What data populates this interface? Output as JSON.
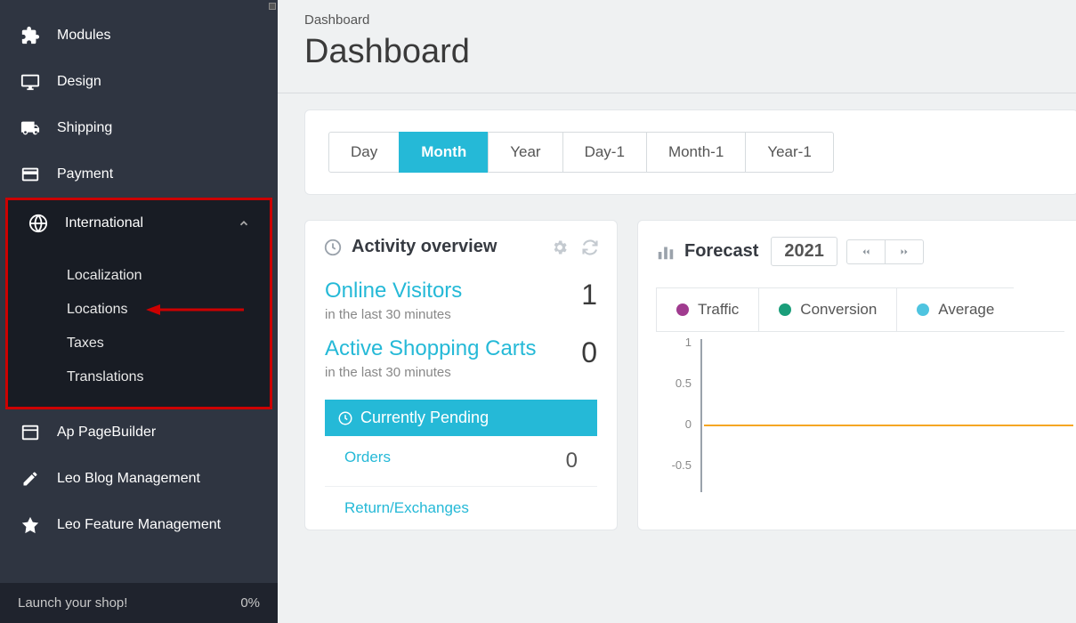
{
  "sidebar": {
    "items": [
      {
        "label": "Modules",
        "icon": "puzzle-icon"
      },
      {
        "label": "Design",
        "icon": "monitor-icon"
      },
      {
        "label": "Shipping",
        "icon": "truck-icon"
      },
      {
        "label": "Payment",
        "icon": "card-icon"
      },
      {
        "label": "International",
        "icon": "globe-icon",
        "expanded": true,
        "children": [
          "Localization",
          "Locations",
          "Taxes",
          "Translations"
        ]
      },
      {
        "label": "Ap PageBuilder",
        "icon": "window-icon"
      },
      {
        "label": "Leo Blog Management",
        "icon": "pencil-icon"
      },
      {
        "label": "Leo Feature Management",
        "icon": "star-icon"
      }
    ],
    "footer": {
      "label": "Launch your shop!",
      "progress": "0%"
    }
  },
  "header": {
    "breadcrumb": "Dashboard",
    "title": "Dashboard"
  },
  "range": {
    "options": [
      "Day",
      "Month",
      "Year",
      "Day-1",
      "Month-1",
      "Year-1"
    ],
    "active": 1
  },
  "activity": {
    "title": "Activity overview",
    "stats": [
      {
        "title": "Online Visitors",
        "sub": "in the last 30 minutes",
        "value": "1"
      },
      {
        "title": "Active Shopping Carts",
        "sub": "in the last 30 minutes",
        "value": "0"
      }
    ],
    "pending": {
      "title": "Currently Pending",
      "items": [
        {
          "label": "Orders",
          "value": "0"
        },
        {
          "label": "Return/Exchanges",
          "value": ""
        }
      ]
    }
  },
  "forecast": {
    "title": "Forecast",
    "year": "2021",
    "tabs": [
      {
        "label": "Traffic",
        "color": "#a03b8f"
      },
      {
        "label": "Conversion",
        "color": "#1a9e7a"
      },
      {
        "label": "Average",
        "color": "#4fc4e0"
      }
    ]
  },
  "chart_data": {
    "type": "line",
    "title": "Forecast",
    "ylabel": "",
    "xlabel": "",
    "ylim": [
      -0.5,
      1.0
    ],
    "yticks": [
      1.0,
      0.5,
      0.0,
      -0.5
    ],
    "series": [
      {
        "name": "Traffic",
        "color": "#f5a623",
        "values": [
          0,
          0,
          0,
          0,
          0,
          0,
          0,
          0,
          0,
          0,
          0,
          0
        ]
      }
    ]
  }
}
